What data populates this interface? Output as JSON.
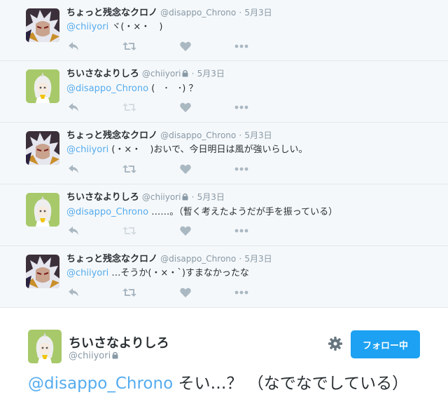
{
  "colors": {
    "link": "#55acee",
    "follow_button": "#1da1f2",
    "muted": "#8899a6",
    "background": "#f5f8fa"
  },
  "tweets": [
    {
      "name": "ちょっと残念なクロノ",
      "handle": "@disappo_Chrono",
      "protected": false,
      "sep": "·",
      "time": "5月3日",
      "mention": "@chiiyori",
      "text": " ヾ(・×・　)",
      "avatar": "chrono-avatar"
    },
    {
      "name": "ちいさなよりしろ",
      "handle": "@chiiyori",
      "protected": true,
      "sep": "·",
      "time": "5月3日",
      "mention": "@disappo_Chrono",
      "text": " (　･　･) ？",
      "avatar": "yorishiro-avatar"
    },
    {
      "name": "ちょっと残念なクロノ",
      "handle": "@disappo_Chrono",
      "protected": false,
      "sep": "·",
      "time": "5月3日",
      "mention": "@chiiyori",
      "text": " (・×・　)おいで、今日明日は風が強いらしい。",
      "avatar": "chrono-avatar"
    },
    {
      "name": "ちいさなよりしろ",
      "handle": "@chiiyori",
      "protected": true,
      "sep": "·",
      "time": "5月3日",
      "mention": "@disappo_Chrono",
      "text": " ……。（暫く考えたようだが手を振っている）",
      "avatar": "yorishiro-avatar"
    },
    {
      "name": "ちょっと残念なクロノ",
      "handle": "@disappo_Chrono",
      "protected": false,
      "sep": "·",
      "time": "5月3日",
      "mention": "@chiiyori",
      "text": " …そうか(・×・`)すまなかったな",
      "avatar": "chrono-avatar"
    }
  ],
  "actions": [
    "reply-icon",
    "retweet-icon",
    "like-icon",
    "more-icon"
  ],
  "main_tweet": {
    "name": "ちいさなよりしろ",
    "handle": "@chiiyori",
    "protected": true,
    "mention": "@disappo_Chrono",
    "text": " そい…？ （なでなでしている）",
    "follow_label": "フォロー中"
  }
}
